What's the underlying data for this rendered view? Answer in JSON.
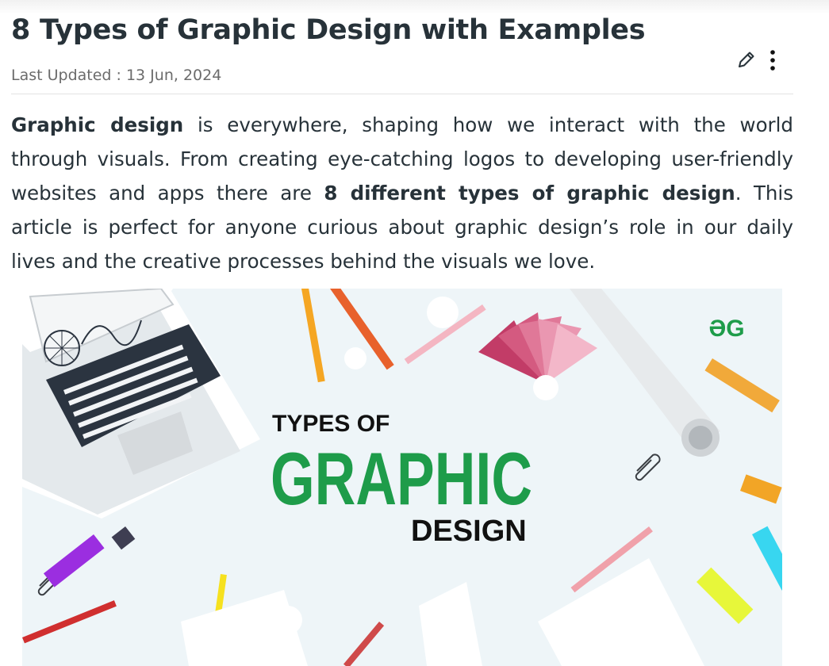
{
  "article": {
    "title": "8 Types of Graphic Design with Examples",
    "last_updated": "Last Updated : 13 Jun, 2024",
    "intro": {
      "lead_bold": "Graphic design",
      "part1": " is everywhere, shaping how we interact with the world through visuals. From creating eye-catching logos to developing user-friendly websites and apps there are ",
      "mid_bold": "8 different types of graphic design",
      "part2": ". This article is perfect for anyone curious about graphic design’s role in our daily lives and the creative processes behind the visuals we love."
    }
  },
  "actions": {
    "edit_icon": "pencil-icon",
    "more_icon": "kebab-menu-icon"
  },
  "banner": {
    "line1": "TYPES OF",
    "line2": "GRAPHIC",
    "line3": "DESIGN",
    "logo": "ƏG",
    "colors": {
      "background": "#eef5f8",
      "accent_green": "#1e9c4a",
      "text_dark": "#111111"
    }
  }
}
